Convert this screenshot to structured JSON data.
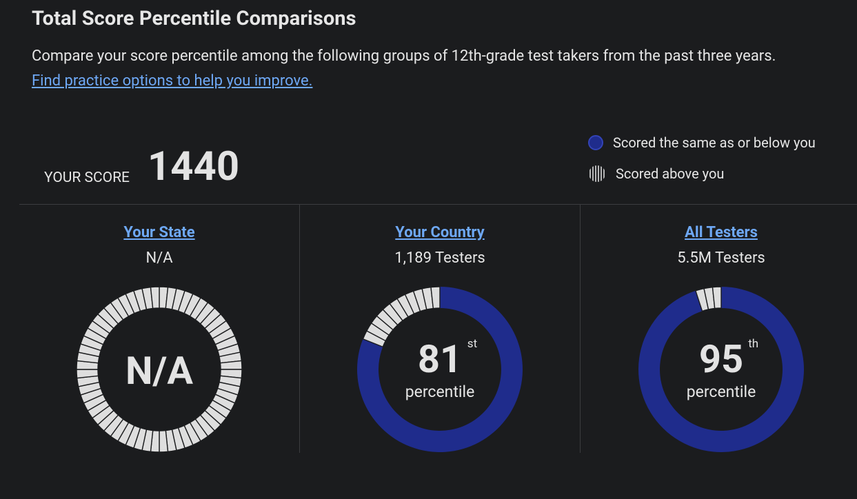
{
  "header": {
    "title": "Total Score Percentile Comparisons",
    "description": "Compare your score percentile among the following groups of 12th-grade test takers from the past three years.",
    "practice_link": "Find practice options to help you improve."
  },
  "score": {
    "label": "YOUR SCORE",
    "value": "1440"
  },
  "legend": {
    "below_label": "Scored the same as or below you",
    "above_label": "Scored above you"
  },
  "colors": {
    "below": "#1f2c8c",
    "above": "#dedede",
    "link": "#6ea8f5",
    "background": "#1b1c1e"
  },
  "groups": [
    {
      "title": "Your State",
      "subtitle": "N/A",
      "center_text": "N/A",
      "percentile": null
    },
    {
      "title": "Your Country",
      "subtitle": "1,189 Testers",
      "percentile_number": "81",
      "percentile_suffix": "st",
      "percentile_word": "percentile",
      "percentile": 81
    },
    {
      "title": "All Testers",
      "subtitle": "5.5M Testers",
      "percentile_number": "95",
      "percentile_suffix": "th",
      "percentile_word": "percentile",
      "percentile": 95
    }
  ]
}
